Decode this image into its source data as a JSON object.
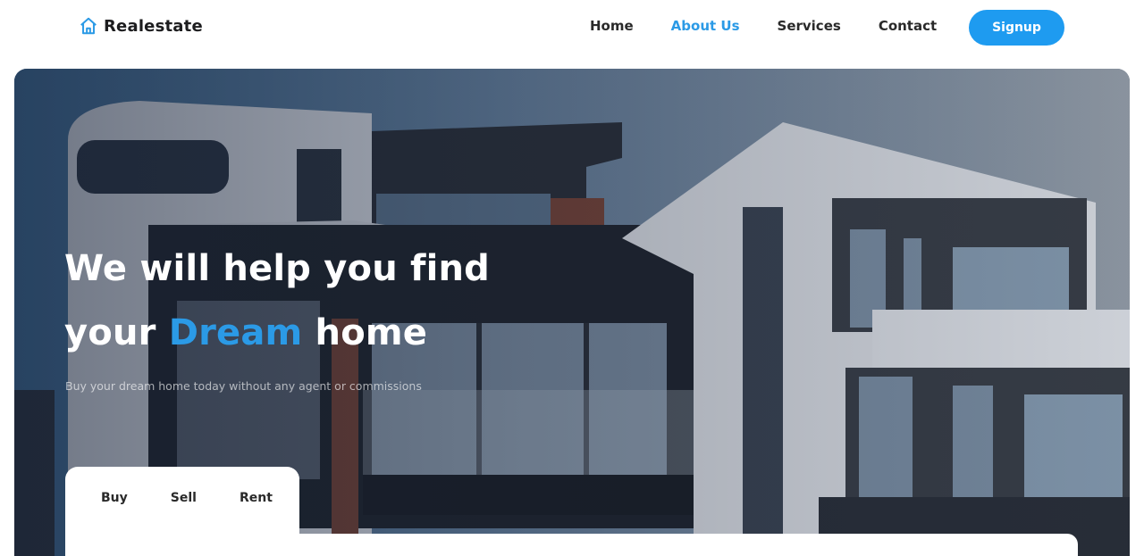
{
  "brand": {
    "name": "Realestate",
    "icon": "house-icon"
  },
  "nav": {
    "items": [
      {
        "label": "Home",
        "active": false
      },
      {
        "label": "About Us",
        "active": true
      },
      {
        "label": "Services",
        "active": false
      },
      {
        "label": "Contact",
        "active": false
      }
    ],
    "signup_label": "Signup"
  },
  "hero": {
    "title_line1": "We will help you find",
    "title_line2_prefix": "your ",
    "title_line2_accent": "Dream",
    "title_line2_suffix": " home",
    "subtitle": "Buy your dream home today without any agent or commissions"
  },
  "search": {
    "tabs": [
      "Buy",
      "Sell",
      "Rent"
    ]
  },
  "colors": {
    "accent": "#1e9bf0",
    "nav_active": "#2b9ae6",
    "text_dark": "#2a2a2a"
  }
}
